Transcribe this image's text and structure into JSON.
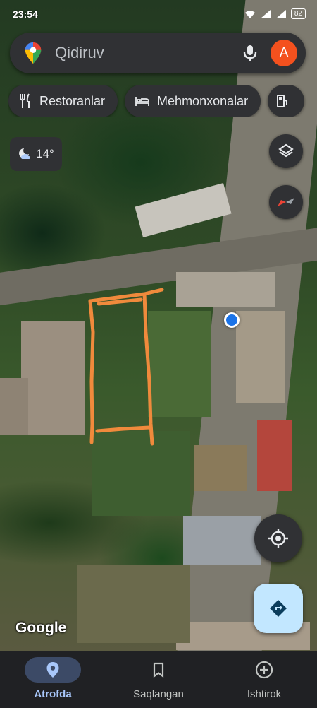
{
  "status_bar": {
    "time": "23:54",
    "battery": "82"
  },
  "search": {
    "placeholder": "Qidiruv",
    "avatar_letter": "A"
  },
  "chips": [
    {
      "label": "Restoranlar",
      "icon": "fork-knife-icon"
    },
    {
      "label": "Mehmonxonalar",
      "icon": "bed-icon"
    },
    {
      "label": "",
      "icon": "gas-station-icon"
    }
  ],
  "weather": {
    "temperature": "14°",
    "icon": "moon-cloud-icon"
  },
  "map": {
    "attribution": "Google",
    "annotation_color": "#f08a3c"
  },
  "nav": {
    "items": [
      {
        "label": "Atrofda",
        "icon": "location-pin-icon",
        "active": true
      },
      {
        "label": "Saqlangan",
        "icon": "bookmark-icon",
        "active": false
      },
      {
        "label": "Ishtirok",
        "icon": "add-circle-icon",
        "active": false
      }
    ]
  },
  "colors": {
    "accent": "#a8c7fa",
    "surface": "#303134",
    "directions_bg": "#c2e7ff",
    "avatar_bg": "#f4511e",
    "location_dot": "#1a73e8"
  }
}
